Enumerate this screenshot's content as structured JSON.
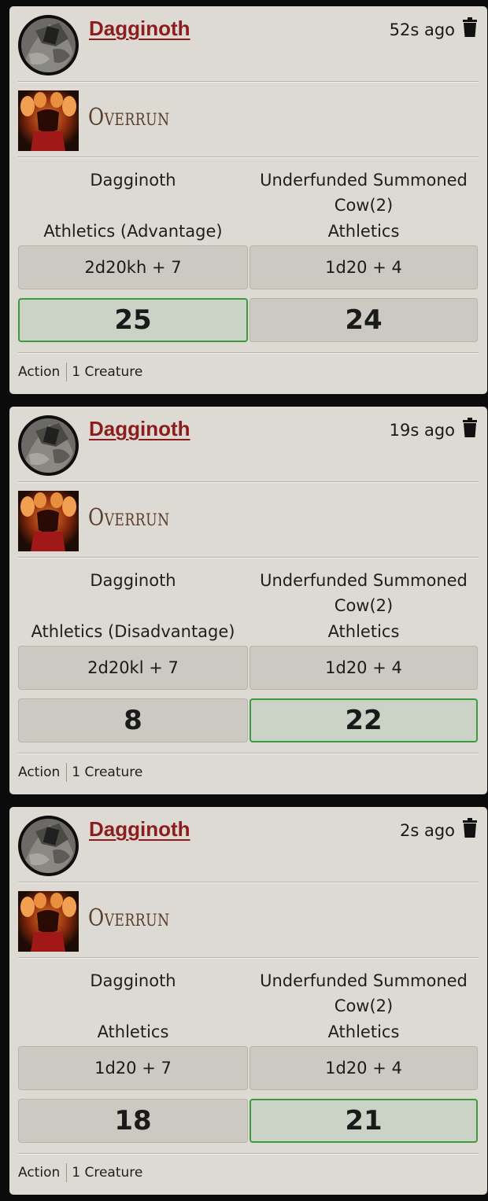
{
  "rolls": [
    {
      "speaker": "Dagginoth",
      "timestamp": "52s ago",
      "item_name": "Overrun",
      "left_name": "Dagginoth",
      "left_skill": "Athletics (Advantage)",
      "left_formula": "2d20kh + 7",
      "left_total": "25",
      "left_winner": true,
      "right_name_line1": "Underfunded Summoned",
      "right_name_line2": "Cow(2)",
      "right_skill": "Athletics",
      "right_formula": "1d20 + 4",
      "right_total": "24",
      "right_winner": false,
      "footer_activation": "Action",
      "footer_target": "1 Creature"
    },
    {
      "speaker": "Dagginoth",
      "timestamp": "19s ago",
      "item_name": "Overrun",
      "left_name": "Dagginoth",
      "left_skill": "Athletics (Disadvantage)",
      "left_formula": "2d20kl + 7",
      "left_total": "8",
      "left_winner": false,
      "right_name_line1": "Underfunded Summoned",
      "right_name_line2": "Cow(2)",
      "right_skill": "Athletics",
      "right_formula": "1d20 + 4",
      "right_total": "22",
      "right_winner": true,
      "footer_activation": "Action",
      "footer_target": "1 Creature"
    },
    {
      "speaker": "Dagginoth",
      "timestamp": "2s ago",
      "item_name": "Overrun",
      "left_name": "Dagginoth",
      "left_skill": "Athletics",
      "left_formula": "1d20 + 7",
      "left_total": "18",
      "left_winner": false,
      "right_name_line1": "Underfunded Summoned",
      "right_name_line2": "Cow(2)",
      "right_skill": "Athletics",
      "right_formula": "1d20 + 4",
      "right_total": "21",
      "right_winner": true,
      "footer_activation": "Action",
      "footer_target": "1 Creature"
    }
  ],
  "icons": {
    "avatar": "armored-portrait-avatar",
    "item": "overrun-ability-icon",
    "delete": "trash-icon"
  },
  "colors": {
    "card_background": "#dcdad2",
    "speaker_link": "#8d1c1c",
    "winner_border": "#3e9a3e",
    "winner_fill": "#cbd3c6",
    "item_title": "#5a3e2e"
  }
}
